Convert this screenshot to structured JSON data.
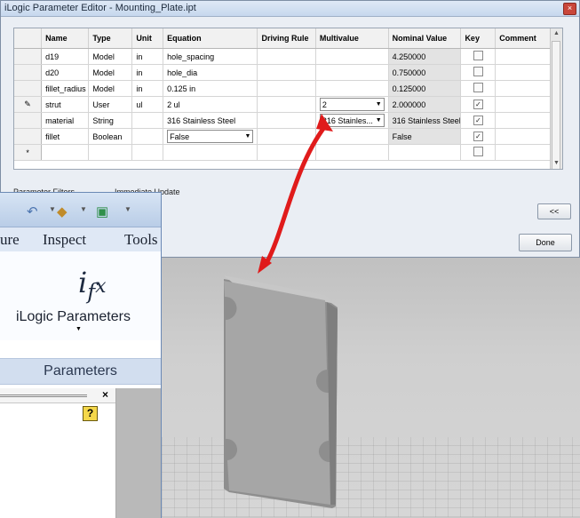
{
  "window": {
    "title": "iLogic Parameter Editor - Mounting_Plate.ipt",
    "close_glyph": "×"
  },
  "table": {
    "columns": [
      "Name",
      "Type",
      "Unit",
      "Equation",
      "Driving Rule",
      "Multivalue",
      "Nominal Value",
      "Key",
      "Comment"
    ],
    "rows": [
      {
        "marker": "",
        "name": "d19",
        "type": "Model",
        "unit": "in",
        "equation": "hole_spacing",
        "multivalue": "",
        "nominal": "4.250000",
        "key": false
      },
      {
        "marker": "",
        "name": "d20",
        "type": "Model",
        "unit": "in",
        "equation": "hole_dia",
        "multivalue": "",
        "nominal": "0.750000",
        "key": false
      },
      {
        "marker": "",
        "name": "fillet_radius",
        "type": "Model",
        "unit": "in",
        "equation": "0.125 in",
        "multivalue": "",
        "nominal": "0.125000",
        "key": false
      },
      {
        "marker": "✎",
        "name": "strut",
        "type": "User",
        "unit": "ul",
        "equation": "2 ul",
        "multivalue": "2",
        "nominal": "2.000000",
        "key": true
      },
      {
        "marker": "",
        "name": "material",
        "type": "String",
        "unit": "",
        "equation": "316 Stainless Steel",
        "multivalue": "316 Stainles...",
        "nominal": "316 Stainless Steel",
        "key": true
      },
      {
        "marker": "",
        "name": "fillet",
        "type": "Boolean",
        "unit": "",
        "equation": "False",
        "multivalue": "",
        "nominal": "False",
        "key": true
      },
      {
        "marker": "*",
        "name": "",
        "type": "",
        "unit": "",
        "equation": "",
        "multivalue": "",
        "nominal": "",
        "key": false
      }
    ]
  },
  "footer": {
    "filters_label": "Parameter Filters",
    "immediate_update_label": "Immediate Update",
    "collapse_label": "<<",
    "done_label": "Done"
  },
  "ribbon": {
    "tabs": [
      "ure",
      "Inspect",
      "Tools"
    ],
    "ilogic_label": "iLogic Parameters",
    "panel_label": "Parameters",
    "browser_close": "×",
    "help_glyph": "?"
  },
  "colors": {
    "arrow": "#e01b1b",
    "part": "#a9a9a9",
    "ribbon_accent": "#6b89b5"
  }
}
